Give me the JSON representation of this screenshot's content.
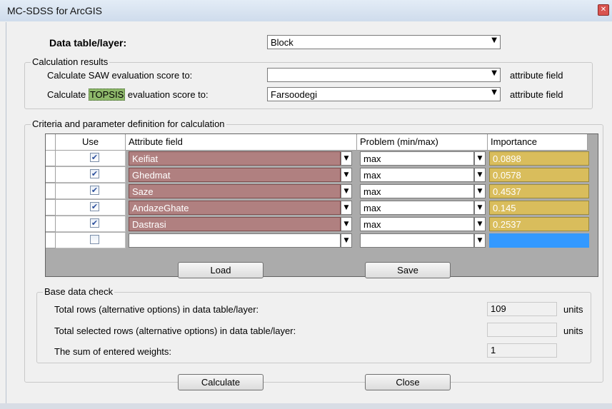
{
  "window": {
    "title": "MC-SDSS for ArcGIS",
    "close_glyph": "✕"
  },
  "data_table": {
    "label": "Data table/layer:",
    "value": "Block"
  },
  "calc_results": {
    "legend": "Calculation results",
    "saw": {
      "label": "Calculate SAW evaluation score to:",
      "value": "",
      "suffix": "attribute field"
    },
    "topsis": {
      "label_pre": "Calculate ",
      "label_hl": "TOPSIS",
      "label_post": " evaluation score to:",
      "value": "Farsoodegi",
      "suffix": "attribute field"
    }
  },
  "criteria": {
    "legend": "Criteria and parameter definition for calculation",
    "columns": [
      "Use",
      "Attribute field",
      "Problem (min/max)",
      "Importance"
    ],
    "rows": [
      {
        "use": true,
        "attribute": "Keifiat",
        "problem": "max",
        "importance": "0.0898"
      },
      {
        "use": true,
        "attribute": "Ghedmat",
        "problem": "max",
        "importance": "0.0578"
      },
      {
        "use": true,
        "attribute": "Saze",
        "problem": "max",
        "importance": "0.4537"
      },
      {
        "use": true,
        "attribute": "AndazeGhate",
        "problem": "max",
        "importance": "0.145"
      },
      {
        "use": true,
        "attribute": "Dastrasi",
        "problem": "max",
        "importance": "0.2537"
      },
      {
        "use": false,
        "attribute": "",
        "problem": "",
        "importance": ""
      }
    ],
    "load_label": "Load",
    "save_label": "Save"
  },
  "base_check": {
    "legend": "Base data check",
    "total_rows": {
      "label": "Total rows (alternative options) in data table/layer:",
      "value": "109",
      "unit": "units"
    },
    "selected_rows": {
      "label": "Total selected rows (alternative options) in data table/layer:",
      "value": "",
      "unit": "units"
    },
    "sum_weights": {
      "label": "The sum of entered weights:",
      "value": "1"
    }
  },
  "buttons": {
    "calculate": "Calculate",
    "close": "Close"
  },
  "icons": {
    "dropdown": "chevron-down-icon",
    "check": "check-icon"
  },
  "colors": {
    "attr_cell": "#b08080",
    "importance_cell": "#d9bd5c",
    "selected_cell": "#3399ff"
  }
}
